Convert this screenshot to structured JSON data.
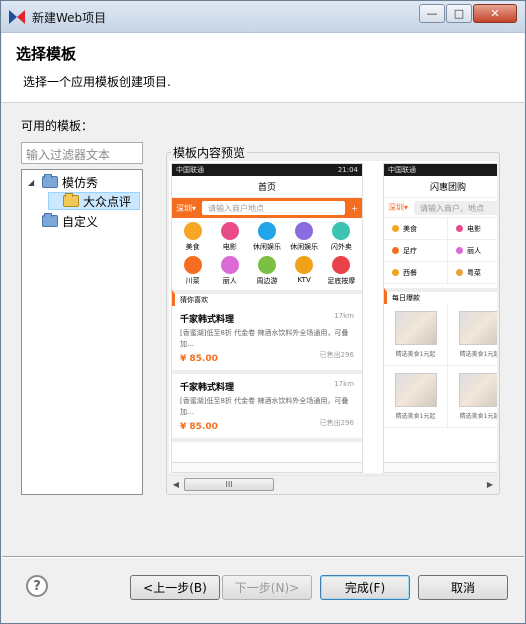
{
  "window": {
    "title": "新建Web项目"
  },
  "header": {
    "title": "选择模板",
    "description": "选择一个应用模板创建项目."
  },
  "templates": {
    "label": "可用的模板：",
    "filter_placeholder": "输入过滤器文本",
    "tree": [
      {
        "label": "模仿秀",
        "expanded": true
      },
      {
        "label": "大众点评",
        "selected": true
      },
      {
        "label": "自定义"
      }
    ]
  },
  "preview": {
    "legend": "模板内容预览",
    "phone1": {
      "status_left": "中国联通",
      "status_right": "21:04",
      "title": "首页",
      "city": "深圳",
      "search_placeholder": "请输入商户地点",
      "plus": "+",
      "categories": [
        {
          "label": "美食",
          "color": "#f5a623"
        },
        {
          "label": "电影",
          "color": "#e94b8a"
        },
        {
          "label": "休闲娱乐",
          "color": "#22a4e8"
        },
        {
          "label": "休闲娱乐",
          "color": "#8b6be0"
        },
        {
          "label": "闪外卖",
          "color": "#3cc3b1"
        },
        {
          "label": "川菜",
          "color": "#f56d1f"
        },
        {
          "label": "丽人",
          "color": "#d96ad6"
        },
        {
          "label": "周边游",
          "color": "#7bc043"
        },
        {
          "label": "KTV",
          "color": "#f0a21b"
        },
        {
          "label": "足底按摩",
          "color": "#e8434a"
        }
      ],
      "guess_title": "猜你喜欢",
      "items": [
        {
          "name": "千家韩式料理",
          "distance": "17km",
          "desc": "[香蜜湖]低至8折 代金卷 辣酒水饮料外全场通用，可叠加…",
          "price": "¥ 85.00",
          "sold": "已售出296"
        },
        {
          "name": "千家韩式料理",
          "distance": "17km",
          "desc": "[香蜜湖]低至8折 代金卷 辣酒水饮料外全场通用，可叠加…",
          "price": "¥ 85.00",
          "sold": "已售出296"
        }
      ]
    },
    "phone2": {
      "status_left": "中国联通",
      "title": "闪惠团购",
      "city": "深圳",
      "search_placeholder": "请输入商户、地点",
      "categories": [
        {
          "label": "美食",
          "color": "#f5a623"
        },
        {
          "label": "电影",
          "color": "#e94b8a"
        },
        {
          "label": "足疗",
          "color": "#f56d1f"
        },
        {
          "label": "丽人",
          "color": "#d96ad6"
        },
        {
          "label": "西餐",
          "color": "#f0a21b"
        },
        {
          "label": "粤菜",
          "color": "#e8a33a"
        }
      ],
      "daily_title": "每日爆款",
      "deals": [
        "精选美食1元起",
        "精选美食1元起",
        "精选美食1元起",
        "精选美食1元起"
      ]
    },
    "scroll_thumb": "III"
  },
  "buttons": {
    "help": "?",
    "back": "<上一步(B)",
    "next": "下一步(N)>",
    "finish": "完成(F)",
    "cancel": "取消"
  },
  "colors": {
    "accent": "#f56d1f",
    "selection": "#cce8ff"
  }
}
